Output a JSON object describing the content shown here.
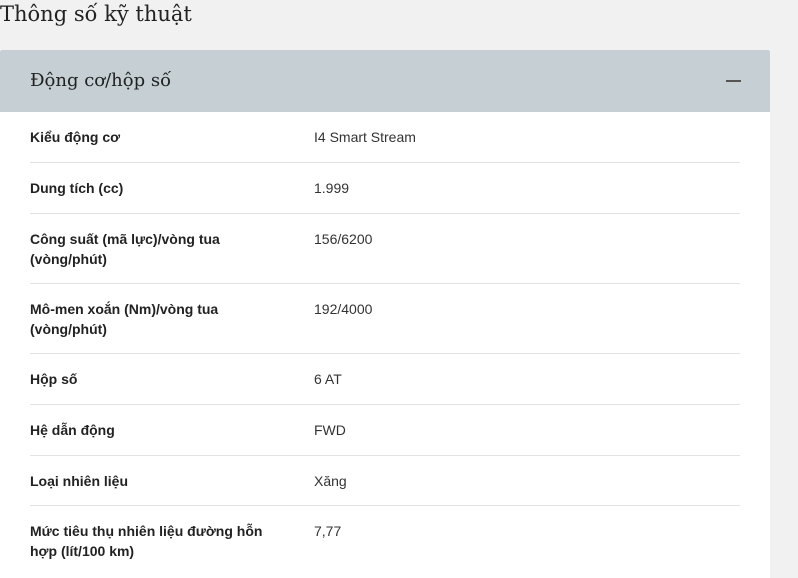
{
  "page": {
    "title": "Thông số kỹ thuật"
  },
  "panel": {
    "title": "Động cơ/hộp số",
    "collapse_icon": "minus-icon",
    "rows": [
      {
        "label": "Kiểu động cơ",
        "value": "I4 Smart Stream"
      },
      {
        "label": "Dung tích (cc)",
        "value": "1.999"
      },
      {
        "label": "Công suất (mã lực)/vòng tua (vòng/phút)",
        "value": "156/6200"
      },
      {
        "label": "Mô-men xoắn (Nm)/vòng tua (vòng/phút)",
        "value": "192/4000"
      },
      {
        "label": "Hộp số",
        "value": "6 AT"
      },
      {
        "label": "Hệ dẫn động",
        "value": "FWD"
      },
      {
        "label": "Loại nhiên liệu",
        "value": "Xăng"
      },
      {
        "label": "Mức tiêu thụ nhiên liệu đường hỗn hợp (lít/100 km)",
        "value": "7,77"
      }
    ]
  },
  "colors": {
    "header_bg": "#c5cfd4",
    "page_bg": "#f1f1f1"
  }
}
